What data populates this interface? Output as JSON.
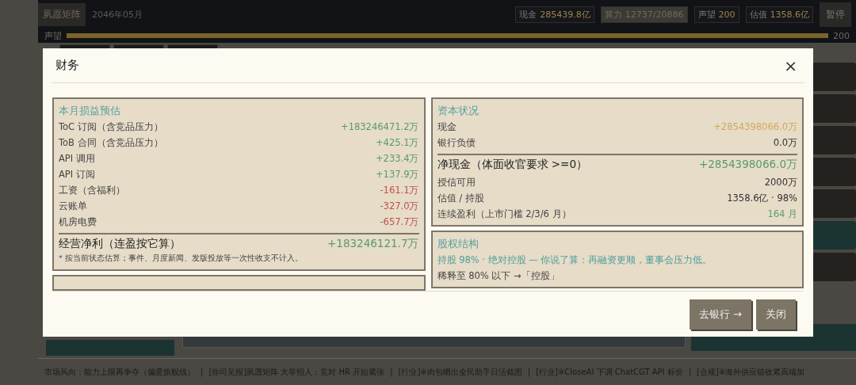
{
  "top_bar": {
    "company": "夙愿矩阵",
    "date": "2046年05月",
    "stats": [
      {
        "label": "现金",
        "value": "285439.8亿",
        "selected": false
      },
      {
        "label": "算力",
        "value": "12737/20886",
        "selected": true
      },
      {
        "label": "声望",
        "value": "200",
        "selected": false
      },
      {
        "label": "估值",
        "value": "1358.6亿",
        "selected": false
      }
    ],
    "pause_button": "暂停"
  },
  "reputation": {
    "label": "声望",
    "level": 1.0,
    "reading": "200"
  },
  "dialog": {
    "title": "财务",
    "close": "×",
    "columns": [
      [
        {
          "title": "本月损益预估",
          "rows": [
            {
              "kind": "item",
              "label": "ToC 订阅（含竞品压力）",
              "value": "+183246471.2万",
              "color": "#5a9a6a"
            },
            {
              "kind": "item",
              "label": "ToB 合同（含竞品压力）",
              "value": "+425.1万",
              "color": "#5a9a6a"
            },
            {
              "kind": "item",
              "label": "API 调用",
              "value": "+233.4万",
              "color": "#5a9a6a"
            },
            {
              "kind": "item",
              "label": "API 订阅",
              "value": "+137.9万",
              "color": "#5a9a6a"
            },
            {
              "kind": "item",
              "label": "工资（含福利）",
              "value": "-161.1万",
              "color": "#c0504d"
            },
            {
              "kind": "item",
              "label": "云账单",
              "value": "-327.0万",
              "color": "#c0504d"
            },
            {
              "kind": "item",
              "label": "机房电费",
              "value": "-657.7万",
              "color": "#c0504d"
            },
            {
              "kind": "total",
              "label": "经营净利（连盈按它算）",
              "value": "+183246121.7万",
              "color": "#5a9a6a"
            },
            {
              "kind": "note",
              "label": "* 按当前状态估算；事件、月度新闻、发版投放等一次性收支不计入。"
            }
          ]
        },
        {
          "kind": "cut"
        }
      ],
      [
        {
          "title": "资本状况",
          "rows": [
            {
              "kind": "item",
              "label": "现金",
              "value": "+2854398066.0万",
              "color": "#d2a85a"
            },
            {
              "kind": "item",
              "label": "银行负债",
              "value": "0.0万",
              "color": "#333333"
            },
            {
              "kind": "total",
              "label": "净现金（体面收官要求 >=0）",
              "value": "+2854398066.0万",
              "color": "#5a9a6a"
            },
            {
              "kind": "item",
              "label": "授信可用",
              "value": "2000万",
              "color": "#333333"
            },
            {
              "kind": "item",
              "label": "估值 / 持股",
              "value": "1358.6亿 · 98%",
              "color": "#333333"
            },
            {
              "kind": "item",
              "label": "连续盈利（上市门槛 2/3/6 月）",
              "value": "164 月",
              "color": "#5a9a6a"
            }
          ]
        },
        {
          "title": "股权结构",
          "rows": [
            {
              "kind": "highlight",
              "label": "持股 98% · 绝对控股 — 你说了算：再融资更顺，董事会压力低。"
            },
            {
              "kind": "plain",
              "label": "稀释至 80% 以下 →「控股」"
            }
          ]
        }
      ]
    ],
    "buttons": [
      {
        "label": "去银行 →"
      },
      {
        "label": "关闭"
      }
    ]
  },
  "ticker": {
    "separator": "|",
    "items": [
      "市场风向：能力上限再争夺（偏爱旗舰线）",
      "[你司见报]夙愿矩阵 大举招人：竞对 HR 开始紧张",
      "[行业]※肉包晒出全民助手日活截图",
      "[行业]※CloseAI 下调 ChatCGT API 标价",
      "[合规]※海外供应链收紧高端加"
    ]
  }
}
